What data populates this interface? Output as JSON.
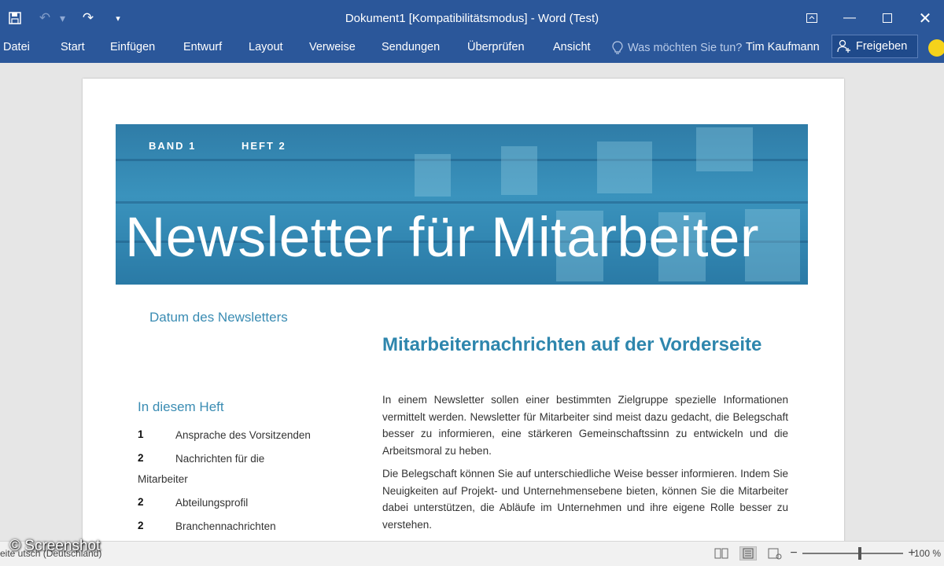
{
  "window": {
    "title": "Dokument1 [Kompatibilitätsmodus] - Word (Test)",
    "qat": {
      "save_icon": "save-icon",
      "undo_icon": "undo-icon",
      "redo_icon": "redo-icon",
      "customize_icon": "customize-qat-icon"
    },
    "controls": [
      "ribbon-display-options-icon",
      "minimize-icon",
      "maximize-icon",
      "close-icon"
    ]
  },
  "ribbon": {
    "tabs": [
      "Datei",
      "Start",
      "Einfügen",
      "Entwurf",
      "Layout",
      "Verweise",
      "Sendungen",
      "Überprüfen",
      "Ansicht"
    ],
    "tell_me": "Was möchten Sie tun?",
    "user": "Tim Kaufmann",
    "share": "Freigeben"
  },
  "document": {
    "band": "BAND 1",
    "heft": "HEFT 2",
    "headline": "Newsletter für Mitarbeiter",
    "date_placeholder": "Datum des Newsletters",
    "heading": "Mitarbeiternachrichten auf der Vorderseite",
    "toc_title": "In diesem Heft",
    "toc": [
      {
        "num": "1",
        "text": "Ansprache des Vorsitzenden",
        "cont": ""
      },
      {
        "num": "2",
        "text": "Nachrichten für die",
        "cont": "Mitarbeiter"
      },
      {
        "num": "2",
        "text": "Abteilungsprofil",
        "cont": ""
      },
      {
        "num": "2",
        "text": "Branchennachrichten",
        "cont": ""
      }
    ],
    "paragraphs": [
      "In einem Newsletter sollen einer bestimmten Zielgruppe spezielle Informationen vermittelt werden. Newsletter für Mitarbeiter sind meist dazu gedacht, die Belegschaft besser zu informieren, eine stärkeren Gemeinschaftssinn zu entwickeln und die Arbeitsmoral zu heben.",
      "Die Belegschaft können Sie auf unterschiedliche Weise besser informieren. Indem Sie Neuigkeiten auf Projekt- und Unternehmensebene bieten, können Sie die Mitarbeiter dabei unterstützen, die Abläufe im Unternehmen und ihre eigene Rolle besser zu verstehen."
    ]
  },
  "statusbar": {
    "language": "eite                    utsch (Deutschland)",
    "zoom": "100 %",
    "zoom_percent": 100
  },
  "watermark": "© Screenshot"
}
